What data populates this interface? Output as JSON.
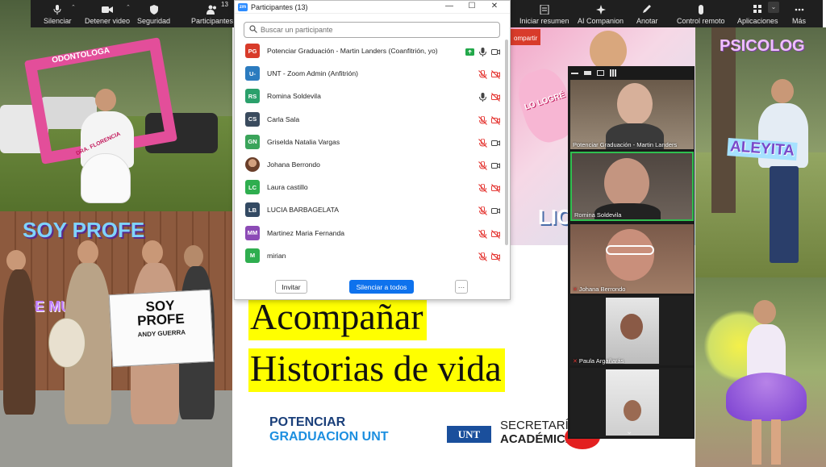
{
  "toolbar": {
    "items": [
      {
        "label": "Silenciar",
        "icon": "microphone-icon"
      },
      {
        "label": "Detener video",
        "icon": "video-camera-icon"
      },
      {
        "label": "Seguridad",
        "icon": "shield-icon"
      },
      {
        "label": "Participantes",
        "icon": "people-icon",
        "count": "13"
      },
      {
        "label": "Iniciar resumen",
        "icon": "summary-icon"
      },
      {
        "label": "AI Companion",
        "icon": "sparkle-icon"
      },
      {
        "label": "Anotar",
        "icon": "pencil-icon"
      },
      {
        "label": "Control remoto",
        "icon": "mouse-icon"
      },
      {
        "label": "Aplicaciones",
        "icon": "apps-icon"
      },
      {
        "label": "Más",
        "icon": "more-icon"
      }
    ]
  },
  "participants_panel": {
    "title": "Participantes (13)",
    "search_placeholder": "Buscar un participante",
    "participants": [
      {
        "initials": "PG",
        "name": "Potenciar Graduación - Martin Landers (Coanfitrión, yo)",
        "color": "#d83b2a",
        "mic": "on",
        "video": "on",
        "sharing": true
      },
      {
        "initials": "U-",
        "name": "UNT - Zoom Admin (Anfitrión)",
        "color": "#2b7bbf",
        "mic": "off",
        "video": "off"
      },
      {
        "initials": "RS",
        "name": "Romina Soldevila",
        "color": "#2aa06b",
        "mic": "on",
        "video": "off"
      },
      {
        "initials": "CS",
        "name": "Carla Sala",
        "color": "#3a4b5e",
        "mic": "off",
        "video": "off"
      },
      {
        "initials": "GN",
        "name": "Griselda Natalia Vargas",
        "color": "#3aa45a",
        "mic": "off",
        "video": "on"
      },
      {
        "initials": "",
        "name": "Johana Berrondo",
        "color": "#8a5a3c",
        "mic": "off",
        "video": "on",
        "photo": true
      },
      {
        "initials": "LC",
        "name": "Laura castillo",
        "color": "#2fae4f",
        "mic": "off",
        "video": "off"
      },
      {
        "initials": "LB",
        "name": "LUCIA BARBAGELATA",
        "color": "#334a63",
        "mic": "off",
        "video": "on"
      },
      {
        "initials": "MM",
        "name": "Martinez Maria Fernanda",
        "color": "#8c4bb6",
        "mic": "off",
        "video": "off"
      },
      {
        "initials": "M",
        "name": "mirian",
        "color": "#2fae4f",
        "mic": "off",
        "video": "off"
      }
    ],
    "invite_label": "Invitar",
    "mute_all_label": "Silenciar a todos",
    "more_label": "···"
  },
  "slide": {
    "line1": "Acompañar",
    "line2": "Historias de vida",
    "brand_line1": "POTENCIAR",
    "brand_line2": "GRADUACION UNT",
    "unt_logo": "UNT",
    "secretaria_line1": "SECRETARÍA",
    "secretaria_line2": "ACADÉMICA",
    "share_tag": "ompartir"
  },
  "photos": {
    "frame_text": "ODONTOLOGA",
    "sash_text": "DRA. FLORENCIA",
    "soy_profe": "SOY PROFE",
    "de_music": "DE MUSIC",
    "banner_line1": "SOY",
    "banner_line2": "PROFE",
    "banner_line3": "ANDY GUERRA",
    "psicolog": "PSICOLOG",
    "aleyita": "ALEYITA",
    "lo_logre": "LO LOGRÉ",
    "lic": "LIC"
  },
  "gallery": {
    "tiles": [
      {
        "name": "Potenciar Graduación - Martin Landers",
        "muted": false
      },
      {
        "name": "Romina Soldevila",
        "muted": false
      },
      {
        "name": "Johana Berrondo",
        "muted": true
      },
      {
        "name": "Paula Argañarás",
        "muted": true
      },
      {
        "name": "",
        "muted": false
      }
    ]
  },
  "colors": {
    "zoom_blue": "#0e72ed",
    "toolbar_bg": "#1f1f1f",
    "slide_yellow": "#ffff00",
    "brand_blue": "#1565c0",
    "muted_red": "#e53935"
  }
}
